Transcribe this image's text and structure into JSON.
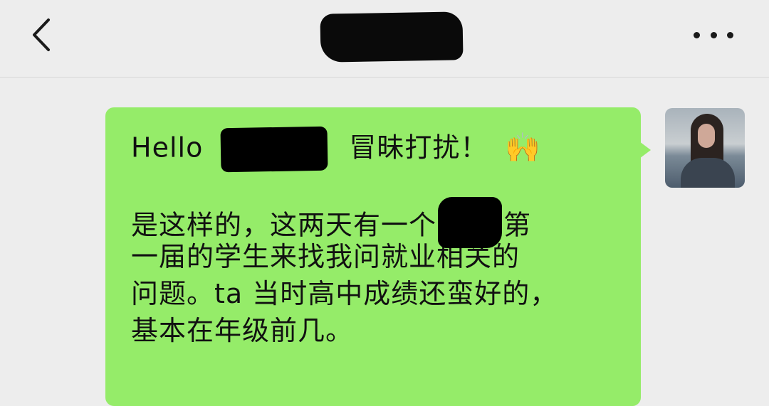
{
  "header": {
    "back_icon": "chevron-left-icon",
    "title_redacted": true,
    "more_icon": "ellipsis-icon"
  },
  "message": {
    "line1_prefix": "Hello ",
    "line1_suffix": "冒昧打扰！",
    "emoji": "🙌",
    "line3_part1": "是这样的，这两天有一个",
    "line3_part2": "第",
    "line4": "一届的学生来找我问就业相关的",
    "line5": "问题。ta 当时高中成绩还蛮好的，",
    "line6": "基本在年级前几。"
  },
  "colors": {
    "bubble": "#95ec69",
    "background": "#ededed",
    "redaction": "#000000"
  }
}
